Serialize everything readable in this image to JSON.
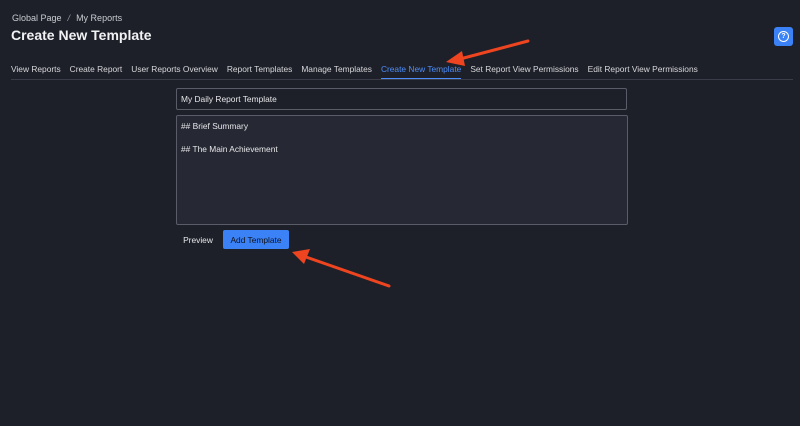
{
  "breadcrumb": {
    "root": "Global Page",
    "separator": "/",
    "current": "My Reports"
  },
  "page_title": "Create New Template",
  "tabs": [
    {
      "label": "View Reports",
      "active": false
    },
    {
      "label": "Create Report",
      "active": false
    },
    {
      "label": "User Reports Overview",
      "active": false
    },
    {
      "label": "Report Templates",
      "active": false
    },
    {
      "label": "Manage Templates",
      "active": false
    },
    {
      "label": "Create New Template",
      "active": true
    },
    {
      "label": "Set Report View Permissions",
      "active": false
    },
    {
      "label": "Edit Report View Permissions",
      "active": false
    }
  ],
  "form": {
    "title_value": "My Daily Report Template",
    "body_value": "## Brief Summary\n\n## The Main Achievement",
    "preview_label": "Preview",
    "submit_label": "Add Template"
  },
  "help": {
    "icon": "question-circle-icon",
    "glyph": "?"
  },
  "colors": {
    "background": "#1e2029",
    "accent": "#3b82f6",
    "active_tab": "#4d8df8",
    "annotation_arrow": "#ee4520"
  }
}
